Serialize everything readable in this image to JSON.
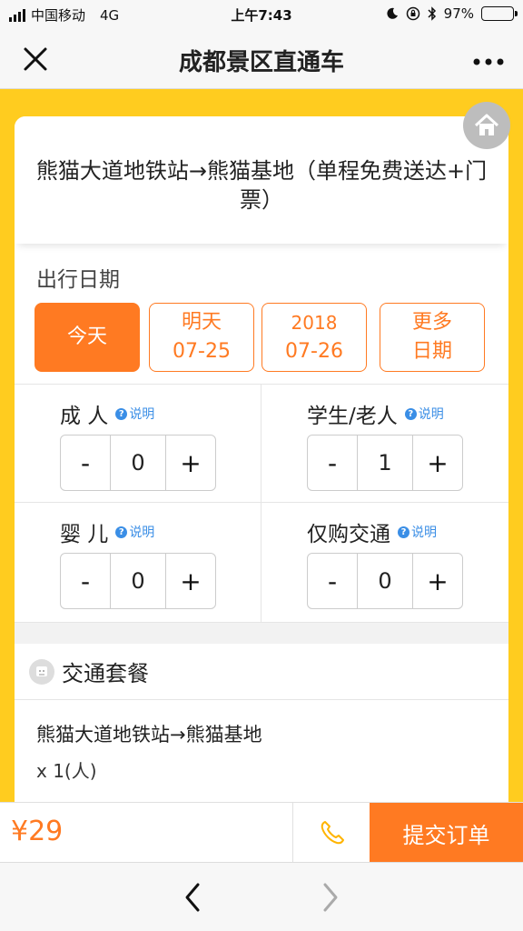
{
  "status_bar": {
    "carrier": "中国移动",
    "network": "4G",
    "time": "上午7:43",
    "battery_text": "97%",
    "battery_level": 0.97
  },
  "nav": {
    "title": "成都景区直通车"
  },
  "route": {
    "title": "熊猫大道地铁站→熊猫基地（单程免费送达+门票）"
  },
  "date_section": {
    "label": "出行日期",
    "options": [
      {
        "line1": "今天",
        "line2": "",
        "active": true
      },
      {
        "line1": "明天",
        "line2": "07-25",
        "active": false
      },
      {
        "line1": "2018",
        "line2": "07-26",
        "active": false
      },
      {
        "line1": "更多",
        "line2": "日期",
        "active": false
      }
    ]
  },
  "help_label": "说明",
  "tickets": [
    {
      "label": "成 人",
      "value": "0"
    },
    {
      "label": "学生/老人",
      "value": "1"
    },
    {
      "label": "婴 儿",
      "value": "0"
    },
    {
      "label": "仅购交通",
      "value": "0"
    }
  ],
  "stepper": {
    "minus": "-",
    "plus": "+"
  },
  "package": {
    "heading": "交通套餐",
    "route": "熊猫大道地铁站→熊猫基地",
    "quantity": "x 1(人)"
  },
  "bottom": {
    "price": "¥29",
    "submit_label": "提交订单"
  },
  "colors": {
    "accent": "#ff7a22",
    "background_yellow": "#ffcc1f",
    "link_blue": "#3a8ee6"
  }
}
